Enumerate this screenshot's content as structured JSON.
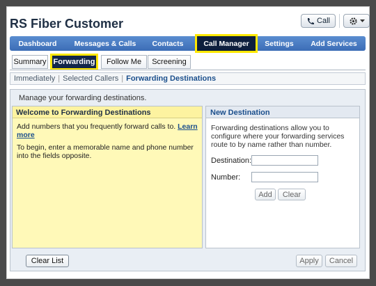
{
  "app": {
    "title": "RS Fiber Customer",
    "call_label": "Call"
  },
  "nav": {
    "items": [
      "Dashboard",
      "Messages & Calls",
      "Contacts",
      "Call Manager",
      "Settings",
      "Add Services"
    ],
    "active": "Call Manager"
  },
  "subtabs": {
    "items": [
      "Summary",
      "Forwarding",
      "Follow Me",
      "Screening"
    ],
    "active": "Forwarding"
  },
  "breadcrumb": {
    "items": [
      "Immediately",
      "Selected Callers",
      "Forwarding Destinations"
    ],
    "current": "Forwarding Destinations"
  },
  "page": {
    "intro": "Manage your forwarding destinations."
  },
  "welcome": {
    "heading": "Welcome to Forwarding Destinations",
    "text1": "Add numbers that you frequently forward calls to.",
    "learn_more": "Learn more",
    "text2": "To begin, enter a memorable name and phone number into the fields opposite."
  },
  "new_destination": {
    "heading": "New Destination",
    "description": "Forwarding destinations allow you to configure where your forwarding services route to by name rather than number.",
    "destination_label": "Destination:",
    "destination_value": "",
    "number_label": "Number:",
    "number_value": "",
    "add_label": "Add",
    "clear_label": "Clear"
  },
  "footer": {
    "clear_list_label": "Clear List",
    "apply_label": "Apply",
    "cancel_label": "Cancel"
  },
  "colors": {
    "nav_bg": "#4a7cc4",
    "highlight": "#ffe800",
    "welcome_bg": "#fff9b8"
  }
}
